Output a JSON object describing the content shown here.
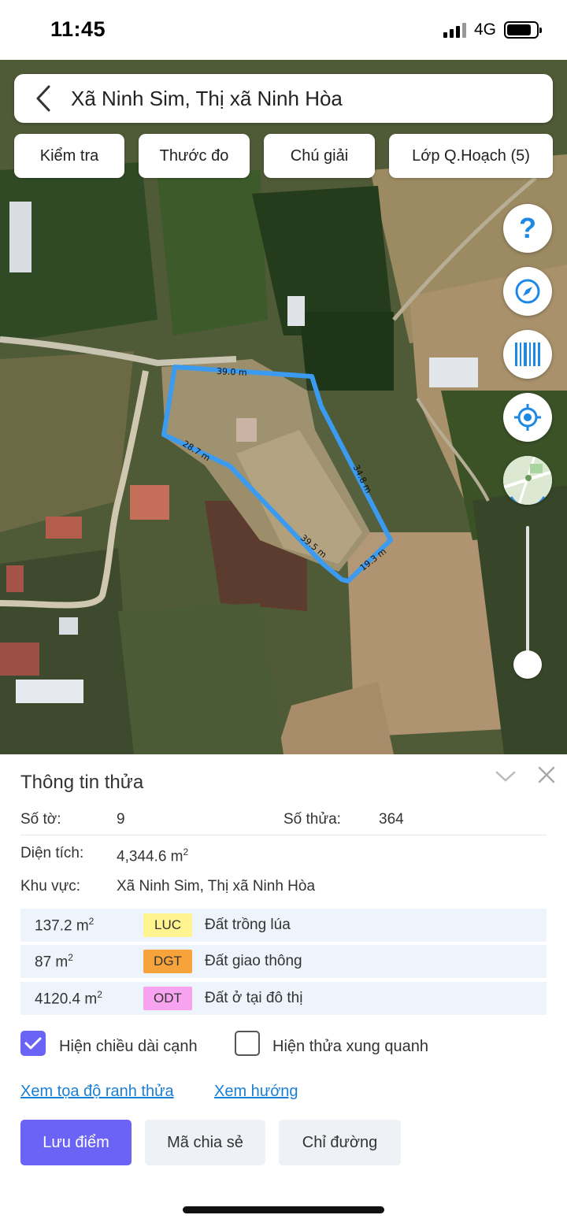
{
  "status_bar": {
    "time": "11:45",
    "network": "4G"
  },
  "header": {
    "title": "Xã Ninh Sim, Thị xã Ninh Hòa"
  },
  "chips": [
    "Kiểm tra",
    "Thước đo",
    "Chú giải",
    "Lớp Q.Hoạch (5)"
  ],
  "map": {
    "edge_labels": [
      "39.0 m",
      "28.7 m",
      "34.8 m",
      "39.5 m",
      "19.3 m"
    ],
    "fab_help_glyph": "?",
    "icons": [
      "help-icon",
      "compass-icon",
      "barcode-icon",
      "locate-icon",
      "map-thumbnail-icon"
    ],
    "parcel_outline_color": "#3b9bf0"
  },
  "sheet": {
    "title": "Thông tin thửa",
    "so_to_label": "Số tờ:",
    "so_to_value": "9",
    "so_thua_label": "Số thửa:",
    "so_thua_value": "364",
    "dien_tich_label": "Diện tích:",
    "dien_tich_value": "4,344.6 m",
    "dien_tich_sup": "2",
    "khu_vuc_label": "Khu vực:",
    "khu_vuc_value": "Xã Ninh Sim, Thị xã Ninh Hòa",
    "land_uses": [
      {
        "area": "137.2 m",
        "sup": "2",
        "code": "LUC",
        "name": "Đất trồng lúa",
        "color": "#fff48f"
      },
      {
        "area": "87 m",
        "sup": "2",
        "code": "DGT",
        "name": "Đất giao thông",
        "color": "#f7a33c"
      },
      {
        "area": "4120.4 m",
        "sup": "2",
        "code": "ODT",
        "name": "Đất ở tại đô thị",
        "color": "#f7a3f0"
      }
    ],
    "show_edge_lengths": {
      "label": "Hiện chiều dài cạnh",
      "checked": true
    },
    "show_neighbors": {
      "label": "Hiện thửa xung quanh",
      "checked": false
    },
    "links": {
      "coords": "Xem tọa độ ranh thửa",
      "direction": "Xem hướng"
    },
    "buttons": {
      "save": "Lưu điểm",
      "share": "Mã chia sẻ",
      "route": "Chỉ đường"
    }
  },
  "colors": {
    "accent": "#6b63f5",
    "link": "#1a7fd4",
    "map_icon": "#1e88e5"
  }
}
